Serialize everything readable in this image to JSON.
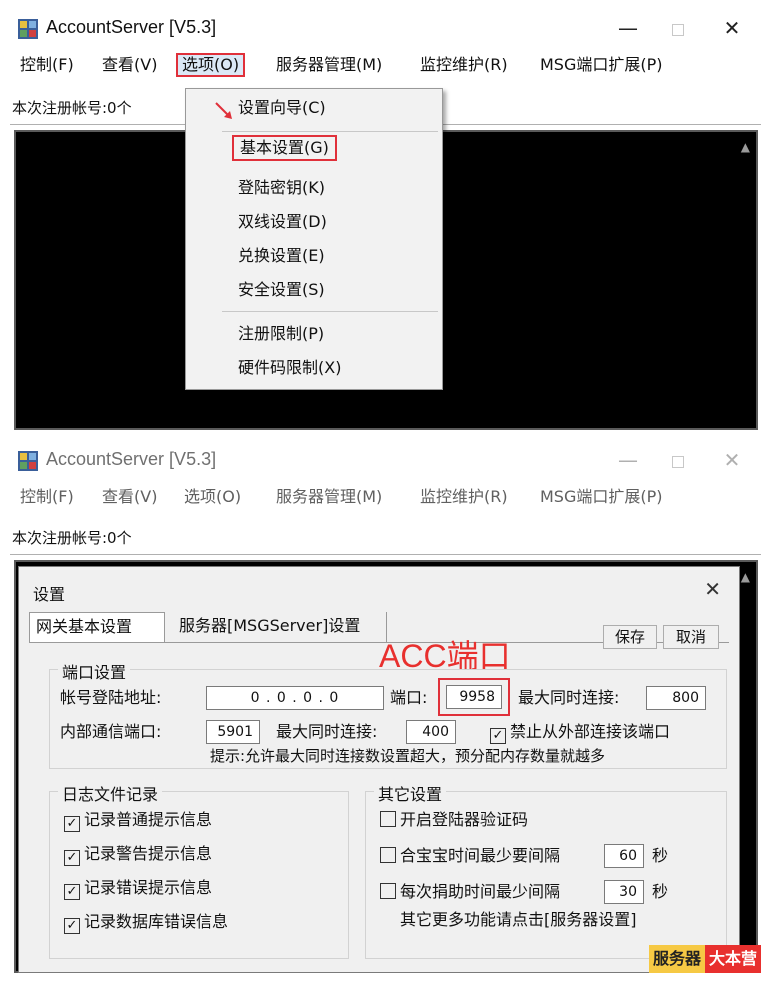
{
  "app": {
    "title": "AccountServer [V5.3]",
    "menus": [
      "控制(F)",
      "查看(V)",
      "选项(O)",
      "服务器管理(M)",
      "监控维护(R)",
      "MSG端口扩展(P)"
    ],
    "status": "本次注册帐号:0个"
  },
  "dropdown": {
    "items": [
      "设置向导(C)",
      "基本设置(G)",
      "登陆密钥(K)",
      "双线设置(D)",
      "兑换设置(E)",
      "安全设置(S)",
      "注册限制(P)",
      "硬件码限制(X)"
    ]
  },
  "dialog": {
    "title": "设置",
    "tabs": [
      "网关基本设置",
      "服务器[MSGServer]设置"
    ],
    "save": "保存",
    "cancel": "取消",
    "annotation": "ACC端口",
    "port_group": {
      "title": "端口设置",
      "login_addr_label": "帐号登陆地址:",
      "login_addr_value": "0 . 0 . 0 . 0",
      "port_label": "端口:",
      "port_value": "9958",
      "max_conn_label": "最大同时连接:",
      "max_conn_value": "800",
      "internal_port_label": "内部通信端口:",
      "internal_port_value": "5901",
      "max_conn2_label": "最大同时连接:",
      "max_conn2_value": "400",
      "block_external": "禁止从外部连接该端口",
      "hint": "提示:允许最大同时连接数设置超大，预分配内存数量就越多"
    },
    "log_group": {
      "title": "日志文件记录",
      "items": [
        "记录普通提示信息",
        "记录警告提示信息",
        "记录错误提示信息",
        "记录数据库错误信息"
      ]
    },
    "other_group": {
      "title": "其它设置",
      "captcha": "开启登陆器验证码",
      "merge_label": "合宝宝时间最少要间隔",
      "merge_value": "60",
      "donate_label": "每次捐助时间最少间隔",
      "donate_value": "30",
      "seconds": "秒",
      "more": "其它更多功能请点击[服务器设置]"
    }
  },
  "watermark": [
    "服务器",
    "大本营"
  ],
  "colors": {
    "highlight_red": "#e0303a",
    "annotation_red": "#e8302e"
  }
}
